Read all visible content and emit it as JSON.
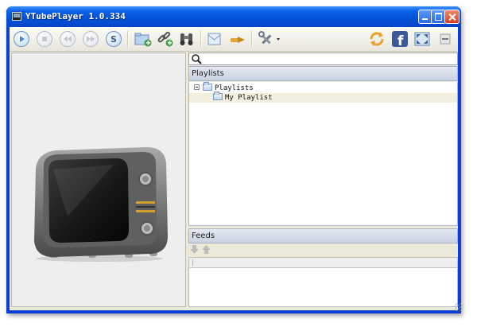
{
  "window": {
    "title": "YTubePlayer 1.0.334"
  },
  "toolbar": {
    "items": [
      "play-icon",
      "stop-icon",
      "previous-icon",
      "next-icon",
      "shuffle-icon",
      "add-folder-icon",
      "add-link-icon",
      "binoculars-icon",
      "import-icon",
      "export-icon",
      "tools-icon",
      "refresh-icon",
      "facebook-icon",
      "fullscreen-icon",
      "minimize-icon"
    ]
  },
  "search": {
    "placeholder": "",
    "value": ""
  },
  "playlists": {
    "header": "Playlists",
    "tree": {
      "root": "Playlists",
      "children": [
        "My Playlist"
      ]
    }
  },
  "feeds": {
    "header": "Feeds"
  },
  "colors": {
    "title_bar": "#0452d8",
    "selection": "#f3efdf",
    "section_header": "#c9d2e1"
  }
}
